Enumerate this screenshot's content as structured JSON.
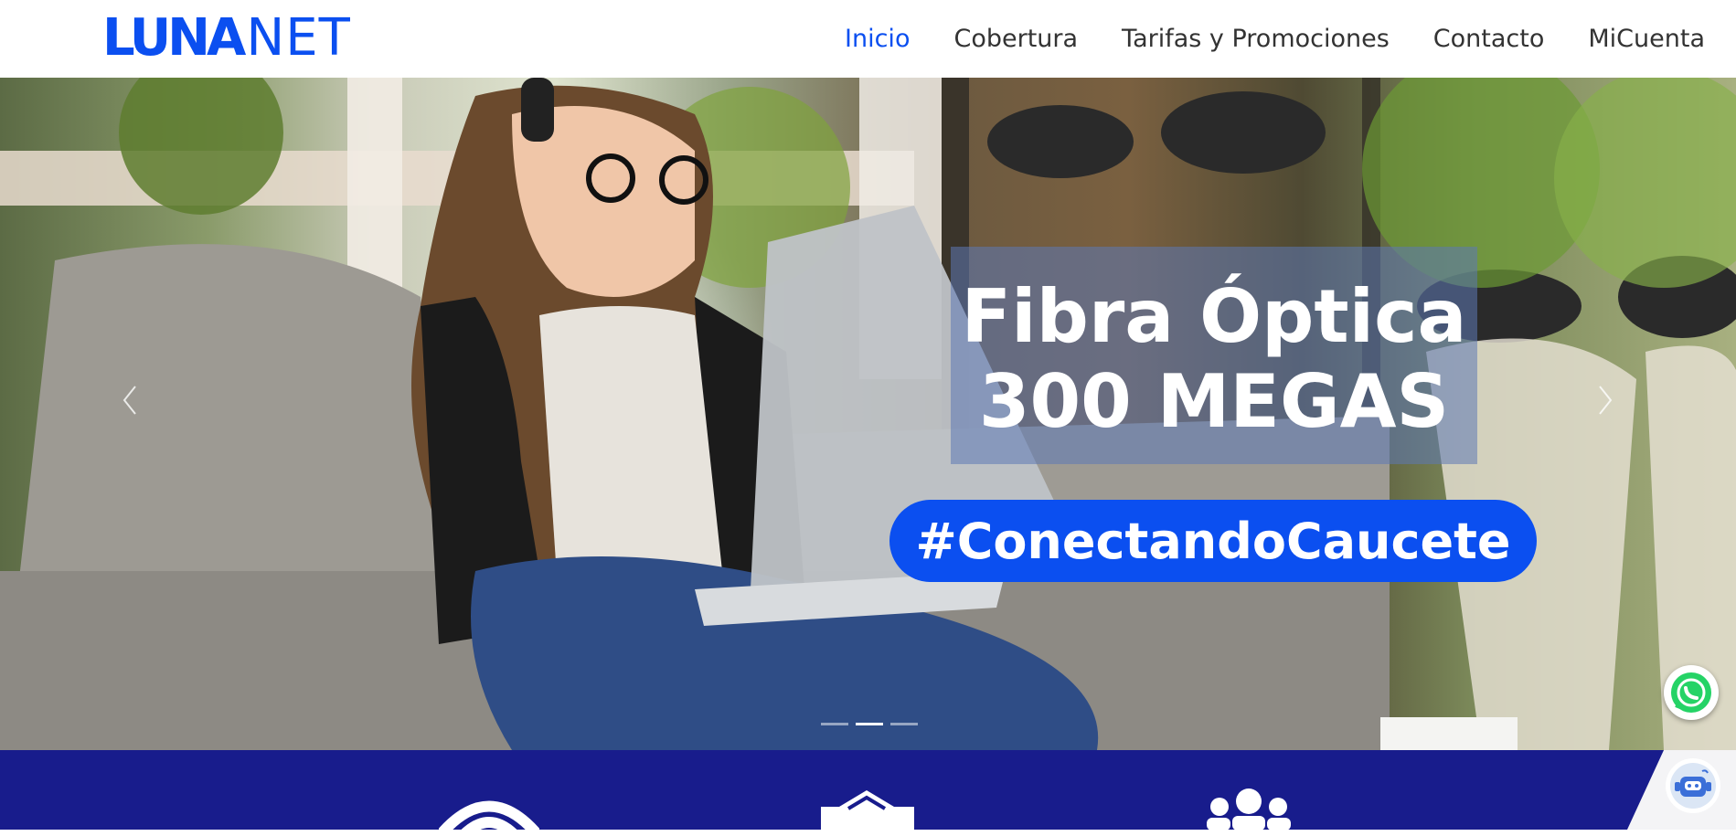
{
  "brand": {
    "logo_bold": "LUNA",
    "logo_thin": "NET",
    "color": "#0b4ff0"
  },
  "nav": {
    "items": [
      {
        "label": "Inicio",
        "active": true
      },
      {
        "label": "Cobertura",
        "active": false
      },
      {
        "label": "Tarifas y Promociones",
        "active": false
      },
      {
        "label": "Contacto",
        "active": false
      },
      {
        "label": "MiCuenta",
        "active": false
      }
    ]
  },
  "hero": {
    "title_line1": "Fibra Óptica",
    "title_line2": "300 MEGAS",
    "hashtag": "#ConectandoCaucete",
    "slide_count": 3,
    "active_slide": 2,
    "prev_icon": "chevron-left-icon",
    "next_icon": "chevron-right-icon"
  },
  "band": {
    "color": "#181c8c",
    "icons": [
      "wifi-icon",
      "handshake-icon",
      "people-icon"
    ]
  },
  "floating": {
    "whatsapp_icon": "whatsapp-icon",
    "chatbot_icon": "chatbot-icon",
    "whatsapp_color": "#25d366"
  }
}
